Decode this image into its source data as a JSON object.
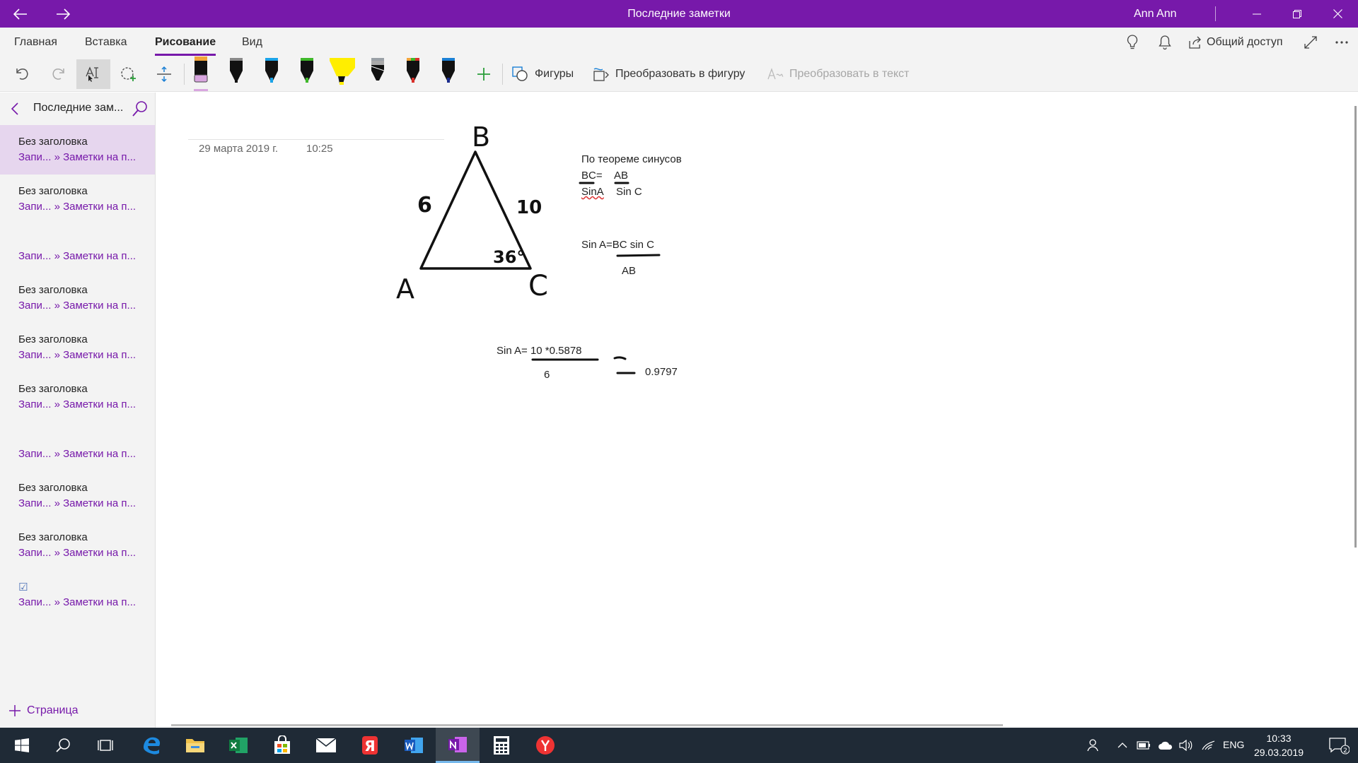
{
  "window": {
    "title": "Последние заметки",
    "user": "Ann Ann"
  },
  "ribbon": {
    "tabs": [
      {
        "label": "Главная"
      },
      {
        "label": "Вставка"
      },
      {
        "label": "Рисование",
        "active": true
      },
      {
        "label": "Вид"
      }
    ],
    "share_label": "Общий доступ"
  },
  "draw_toolbar": {
    "pens": [
      {
        "name": "eraser",
        "color": "#d9a6e0"
      },
      {
        "name": "pen-black-1",
        "color": "#111111"
      },
      {
        "name": "pen-cyan",
        "color": "#1aa3e8"
      },
      {
        "name": "pen-green",
        "color": "#3fb82a"
      },
      {
        "name": "highlighter-yellow",
        "color": "#ffee00"
      },
      {
        "name": "pencil-gray",
        "color": "#111111"
      },
      {
        "name": "pen-red",
        "color": "#d9302a"
      },
      {
        "name": "pen-blue-black",
        "color": "#1a2b8c"
      }
    ],
    "shapes_label": "Фигуры",
    "ink_to_shape_label": "Преобразовать в фигуру",
    "ink_to_text_label": "Преобразовать в текст"
  },
  "sidebar": {
    "title": "Последние зам...",
    "pages": [
      {
        "title": "Без заголовка",
        "subtitle": "Запи... » Заметки на п...",
        "active": true
      },
      {
        "title": "Без заголовка",
        "subtitle": "Запи... » Заметки на п..."
      },
      {
        "title": "",
        "subtitle": "Запи... » Заметки на п..."
      },
      {
        "title": "Без заголовка",
        "subtitle": "Запи... » Заметки на п..."
      },
      {
        "title": "Без заголовка",
        "subtitle": "Запи... » Заметки на п..."
      },
      {
        "title": "Без заголовка",
        "subtitle": "Запи... » Заметки на п..."
      },
      {
        "title": "",
        "subtitle": "Запи... » Заметки на п..."
      },
      {
        "title": "Без заголовка",
        "subtitle": "Запи... » Заметки на п..."
      },
      {
        "title": "Без заголовка",
        "subtitle": "Запи... » Заметки на п..."
      },
      {
        "title": "☑",
        "subtitle": "Запи... » Заметки на п..."
      }
    ],
    "add_page_label": "Страница"
  },
  "note": {
    "date": "29 марта 2019 г.",
    "time": "10:25",
    "ink_labels": {
      "vertex_b": "B",
      "vertex_a": "A",
      "vertex_c": "C",
      "side_ab": "6",
      "side_bc": "10",
      "angle_c": "36°"
    },
    "theorem_title": "По теореме синусов",
    "formula1_num_left": "BC=",
    "formula1_num_right": "AB",
    "formula1_den_left": "SinA",
    "formula1_den_right": "Sin C",
    "formula2_num": "Sin A=BC sin C",
    "formula2_den": "AB",
    "formula3_num": "Sin A= 10 *0.5878",
    "formula3_den": "6",
    "formula3_result": "0.9797"
  },
  "taskbar": {
    "lang": "ENG",
    "time": "10:33",
    "date": "29.03.2019",
    "notifications": "2",
    "apps": [
      "start-icon",
      "search-icon",
      "task-view-icon",
      "edge-icon",
      "file-explorer-icon",
      "excel-icon",
      "store-icon",
      "mail-icon",
      "yandex-browser-icon",
      "word-icon",
      "onenote-icon",
      "calculator-icon",
      "yandex-icon"
    ]
  }
}
